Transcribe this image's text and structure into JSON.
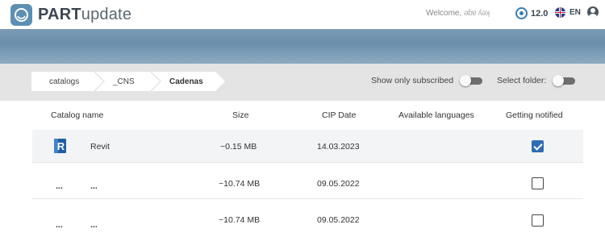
{
  "header": {
    "brand_bold": "PART",
    "brand_light": "update",
    "welcome_label": "Welcome,",
    "welcome_user": "ǝɓɐ ʎǝʞ",
    "version": "12.0",
    "language": "EN"
  },
  "breadcrumb": [
    "catalogs",
    "_CNS",
    "Cadenas"
  ],
  "toggles": {
    "show_subscribed": {
      "label": "Show only subscribed",
      "on": false
    },
    "select_folder": {
      "label": "Select folder:",
      "on": false
    }
  },
  "table": {
    "columns": [
      "Catalog name",
      "Size",
      "CIP Date",
      "Available languages",
      "Getting notified"
    ],
    "rows": [
      {
        "icon": "revit-icon",
        "name": "Revit",
        "size": "~0.15 MB",
        "cip_date": "14.03.2023",
        "languages": "",
        "notified": true
      },
      {
        "icon": "...",
        "name": "...",
        "size": "~10.74 MB",
        "cip_date": "09.05.2022",
        "languages": "",
        "notified": false
      },
      {
        "icon": "...",
        "name": "...",
        "size": "~10.74 MB",
        "cip_date": "09.05.2022",
        "languages": "",
        "notified": false
      }
    ]
  },
  "colors": {
    "accent": "#2f6db3",
    "band": "#6b8fac",
    "logo": "#5d8fb4"
  }
}
